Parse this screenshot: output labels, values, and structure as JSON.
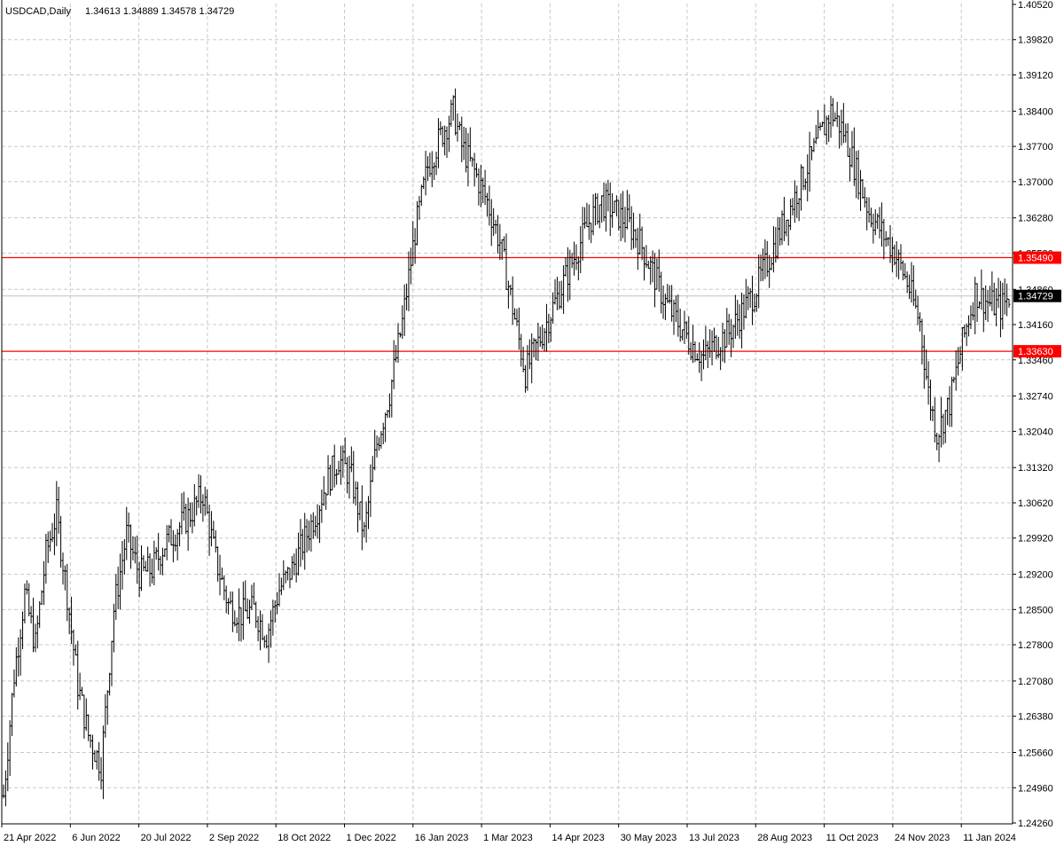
{
  "header": {
    "symbol": "USDCAD,Daily",
    "ohlc": "1.34613 1.34889 1.34578 1.34729"
  },
  "chart_data": {
    "type": "ohlc-bar",
    "title": "USDCAD,Daily",
    "ylim": [
      1.4052,
      1.4052
    ],
    "y_axis": {
      "min": 1.2426,
      "max": 1.4052,
      "ticks": [
        1.4052,
        1.3982,
        1.3912,
        1.384,
        1.377,
        1.37,
        1.3628,
        1.3558,
        1.3486,
        1.3416,
        1.3346,
        1.3274,
        1.3204,
        1.3132,
        1.3062,
        1.2992,
        1.292,
        1.285,
        1.278,
        1.2708,
        1.2638,
        1.2566,
        1.2496,
        1.2426
      ],
      "tick_labels": [
        "1.40520",
        "1.39820",
        "1.39120",
        "1.38400",
        "1.37700",
        "1.37000",
        "1.36280",
        "1.35580",
        "1.34860",
        "1.34160",
        "1.33460",
        "1.32740",
        "1.32040",
        "1.31320",
        "1.30620",
        "1.29920",
        "1.29200",
        "1.28500",
        "1.27800",
        "1.27080",
        "1.26380",
        "1.25660",
        "1.24960",
        "1.24260"
      ]
    },
    "x_axis": {
      "labels": [
        "21 Apr 2022",
        "6 Jun 2022",
        "20 Jul 2022",
        "2 Sep 2022",
        "18 Oct 2022",
        "1 Dec 2022",
        "16 Jan 2023",
        "1 Mar 2023",
        "14 Apr 2023",
        "30 May 2023",
        "13 Jul 2023",
        "28 Aug 2023",
        "11 Oct 2023",
        "24 Nov 2023",
        "11 Jan 2024"
      ],
      "label_bar_index": [
        0,
        32,
        64,
        96,
        128,
        160,
        192,
        224,
        256,
        288,
        320,
        352,
        384,
        416,
        448
      ]
    },
    "grid": true,
    "bar_color": "#000000",
    "horizontal_lines": [
      {
        "price": 1.3549,
        "label": "1.35490",
        "color": "#ff0000"
      },
      {
        "price": 1.3363,
        "label": "1.33630",
        "color": "#ff0000"
      }
    ],
    "current_price": {
      "price": 1.34729,
      "label": "1.34729",
      "line_color": "#c0c0c0"
    },
    "path": [
      [
        0,
        1.248
      ],
      [
        5,
        1.272
      ],
      [
        10,
        1.288
      ],
      [
        15,
        1.278
      ],
      [
        20,
        1.296
      ],
      [
        25,
        1.304
      ],
      [
        30,
        1.288
      ],
      [
        35,
        1.27
      ],
      [
        40,
        1.26
      ],
      [
        46,
        1.254
      ],
      [
        52,
        1.285
      ],
      [
        58,
        1.3
      ],
      [
        64,
        1.292
      ],
      [
        70,
        1.293
      ],
      [
        76,
        1.298
      ],
      [
        82,
        1.301
      ],
      [
        88,
        1.304
      ],
      [
        94,
        1.308
      ],
      [
        100,
        1.295
      ],
      [
        106,
        1.286
      ],
      [
        112,
        1.284
      ],
      [
        118,
        1.285
      ],
      [
        124,
        1.28
      ],
      [
        130,
        1.289
      ],
      [
        136,
        1.293
      ],
      [
        142,
        1.299
      ],
      [
        148,
        1.305
      ],
      [
        152,
        1.31
      ],
      [
        158,
        1.315
      ],
      [
        164,
        1.311
      ],
      [
        170,
        1.3
      ],
      [
        176,
        1.318
      ],
      [
        182,
        1.328
      ],
      [
        188,
        1.342
      ],
      [
        194,
        1.36
      ],
      [
        200,
        1.373
      ],
      [
        206,
        1.379
      ],
      [
        212,
        1.384
      ],
      [
        216,
        1.377
      ],
      [
        222,
        1.372
      ],
      [
        228,
        1.366
      ],
      [
        234,
        1.358
      ],
      [
        240,
        1.345
      ],
      [
        246,
        1.332
      ],
      [
        252,
        1.338
      ],
      [
        258,
        1.344
      ],
      [
        264,
        1.35
      ],
      [
        270,
        1.356
      ],
      [
        276,
        1.362
      ],
      [
        282,
        1.366
      ],
      [
        288,
        1.364
      ],
      [
        294,
        1.362
      ],
      [
        300,
        1.358
      ],
      [
        306,
        1.352
      ],
      [
        312,
        1.346
      ],
      [
        318,
        1.342
      ],
      [
        324,
        1.338
      ],
      [
        330,
        1.335
      ],
      [
        336,
        1.338
      ],
      [
        342,
        1.34
      ],
      [
        348,
        1.344
      ],
      [
        354,
        1.348
      ],
      [
        360,
        1.354
      ],
      [
        366,
        1.36
      ],
      [
        372,
        1.366
      ],
      [
        378,
        1.372
      ],
      [
        384,
        1.378
      ],
      [
        390,
        1.384
      ],
      [
        396,
        1.38
      ],
      [
        402,
        1.372
      ],
      [
        408,
        1.364
      ],
      [
        414,
        1.36
      ],
      [
        420,
        1.356
      ],
      [
        426,
        1.35
      ],
      [
        432,
        1.342
      ],
      [
        436,
        1.328
      ],
      [
        440,
        1.32
      ],
      [
        446,
        1.326
      ],
      [
        452,
        1.338
      ],
      [
        458,
        1.348
      ],
      [
        464,
        1.346
      ],
      [
        470,
        1.345
      ],
      [
        474,
        1.347
      ]
    ],
    "bars_count": 475
  }
}
